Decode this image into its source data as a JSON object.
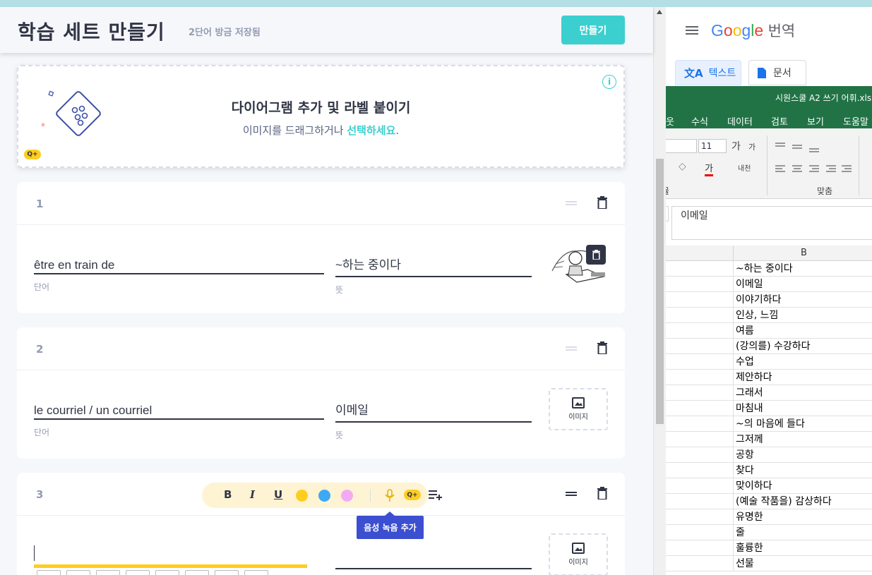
{
  "header": {
    "title": "학습 세트 만들기",
    "saved_status": "2단어 방금 저장됨",
    "create_button": "만들기"
  },
  "diagram": {
    "title": "다이어그램 추가 및 라벨 붙이기",
    "subtitle_prefix": "이미지를 드래그하거나 ",
    "subtitle_link": "선택하세요",
    "subtitle_suffix": ".",
    "info": "i",
    "badge": "Q+"
  },
  "cards": [
    {
      "number": "1",
      "term": "être en train de",
      "term_label": "단어",
      "definition": "~하는 중이다",
      "definition_label": "뜻",
      "has_image": true
    },
    {
      "number": "2",
      "term": "le courriel / un courriel",
      "term_label": "단어",
      "definition": "이메일",
      "definition_label": "뜻",
      "image_label": "이미지"
    },
    {
      "number": "3",
      "term": "",
      "definition": "",
      "image_label": "이미지"
    }
  ],
  "toolbar": {
    "bold": "B",
    "italic": "I",
    "underline": "U",
    "colors": [
      "#ffcd1f",
      "#3da9f5",
      "#f3aaf5"
    ],
    "badge": "Q+",
    "tooltip": "음성 녹음 추가"
  },
  "translate": {
    "logo_google": "Google",
    "logo_product": "번역",
    "tab_text": "텍스트",
    "tab_docs": "문서"
  },
  "excel": {
    "filename": "시원스쿨 A2 쓰기 어휘.xls",
    "menus": [
      "웃",
      "수식",
      "데이터",
      "검토",
      "보기",
      "도움말"
    ],
    "font_size": "11",
    "group_left": "뮬",
    "group_align": "맞춤",
    "formula_value": "이메일",
    "column_header": "B",
    "cells": [
      "~하는 중이다",
      "이메일",
      "이야기하다",
      "인상, 느낌",
      "여름",
      "(강의를) 수강하다",
      "수업",
      "제안하다",
      "그래서",
      "마침내",
      "~의 마음에 들다",
      "그저께",
      "공항",
      "찾다",
      "맞이하다",
      "(예술 작품을) 감상하다",
      "유명한",
      "줄",
      "훌륭한",
      "선물"
    ]
  }
}
